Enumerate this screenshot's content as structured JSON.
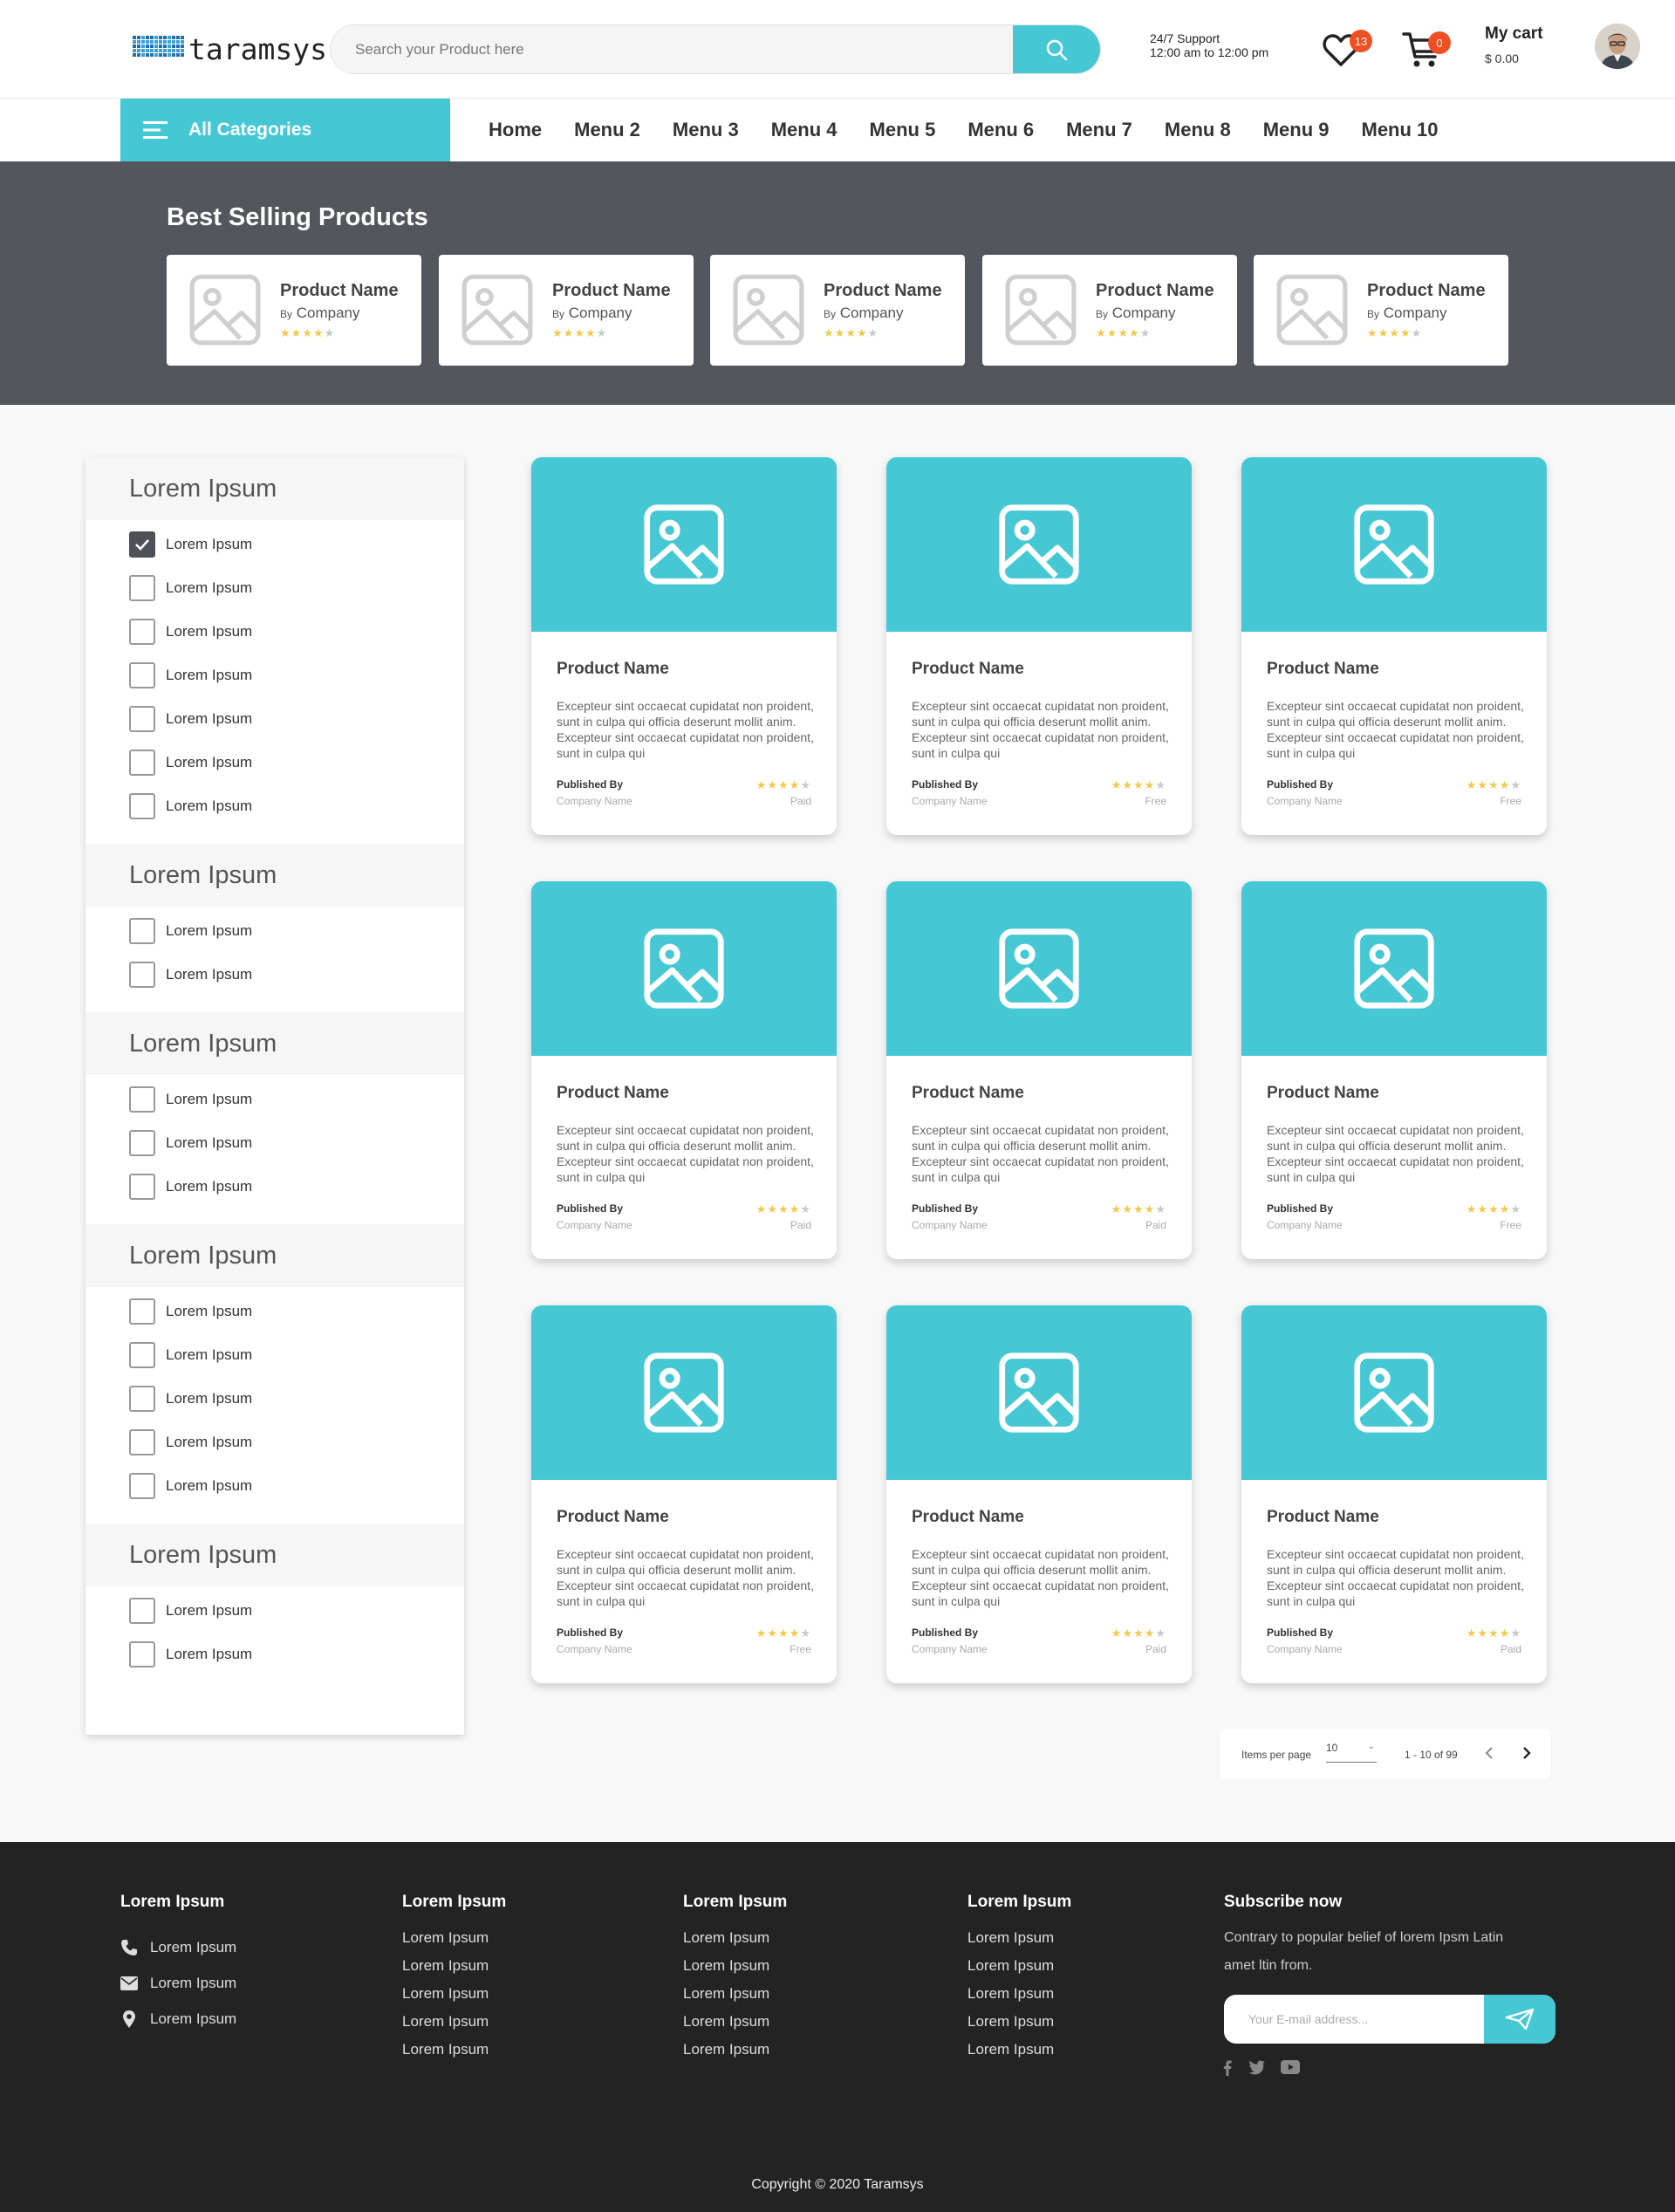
{
  "header": {
    "logo_text": "taramsys",
    "search_placeholder": "Search your Product here",
    "support_line1": "24/7 Support",
    "support_line2": "12:00 am to 12:00 pm",
    "wishlist_count": "13",
    "cart_count": "0",
    "cart_title": "My cart",
    "cart_amount": "$ 0.00"
  },
  "nav": {
    "all_categories": "All Categories",
    "menu": [
      "Home",
      "Menu 2",
      "Menu 3",
      "Menu 4",
      "Menu 5",
      "Menu 6",
      "Menu 7",
      "Menu 8",
      "Menu 9",
      "Menu 10"
    ]
  },
  "best_selling": {
    "title": "Best Selling Products",
    "items": [
      {
        "name": "Product Name",
        "by": "By",
        "company": "Company",
        "rating": 4
      },
      {
        "name": "Product Name",
        "by": "By",
        "company": "Company",
        "rating": 4
      },
      {
        "name": "Product Name",
        "by": "By",
        "company": "Company",
        "rating": 4
      },
      {
        "name": "Product Name",
        "by": "By",
        "company": "Company",
        "rating": 4
      },
      {
        "name": "Product Name",
        "by": "By",
        "company": "Company",
        "rating": 4
      }
    ]
  },
  "filters": [
    {
      "title": "Lorem Ipsum",
      "options": [
        {
          "label": "Lorem Ipsum",
          "checked": true
        },
        {
          "label": "Lorem Ipsum",
          "checked": false
        },
        {
          "label": "Lorem Ipsum",
          "checked": false
        },
        {
          "label": "Lorem Ipsum",
          "checked": false
        },
        {
          "label": "Lorem Ipsum",
          "checked": false
        },
        {
          "label": "Lorem Ipsum",
          "checked": false
        },
        {
          "label": "Lorem Ipsum",
          "checked": false
        }
      ]
    },
    {
      "title": "Lorem Ipsum",
      "options": [
        {
          "label": "Lorem Ipsum",
          "checked": false
        },
        {
          "label": "Lorem Ipsum",
          "checked": false
        }
      ]
    },
    {
      "title": "Lorem Ipsum",
      "options": [
        {
          "label": "Lorem Ipsum",
          "checked": false
        },
        {
          "label": "Lorem Ipsum",
          "checked": false
        },
        {
          "label": "Lorem Ipsum",
          "checked": false
        }
      ]
    },
    {
      "title": "Lorem Ipsum",
      "options": [
        {
          "label": "Lorem Ipsum",
          "checked": false
        },
        {
          "label": "Lorem Ipsum",
          "checked": false
        },
        {
          "label": "Lorem Ipsum",
          "checked": false
        },
        {
          "label": "Lorem Ipsum",
          "checked": false
        },
        {
          "label": "Lorem Ipsum",
          "checked": false
        }
      ]
    },
    {
      "title": "Lorem Ipsum",
      "options": [
        {
          "label": "Lorem Ipsum",
          "checked": false
        },
        {
          "label": "Lorem Ipsum",
          "checked": false
        }
      ]
    }
  ],
  "products": [
    {
      "name": "Product Name",
      "description": "Excepteur sint occaecat cupidatat non proident, sunt in culpa qui officia deserunt mollit anim. Excepteur sint occaecat cupidatat non proident, sunt in culpa qui",
      "published_by": "Published By",
      "company": "Company Name",
      "rating": 4,
      "price": "Paid"
    },
    {
      "name": "Product Name",
      "description": "Excepteur sint occaecat cupidatat non proident, sunt in culpa qui officia deserunt mollit anim. Excepteur sint occaecat cupidatat non proident, sunt in culpa qui",
      "published_by": "Published By",
      "company": "Company Name",
      "rating": 4,
      "price": "Free"
    },
    {
      "name": "Product Name",
      "description": "Excepteur sint occaecat cupidatat non proident, sunt in culpa qui officia deserunt mollit anim. Excepteur sint occaecat cupidatat non proident, sunt in culpa qui",
      "published_by": "Published By",
      "company": "Company Name",
      "rating": 4,
      "price": "Free"
    },
    {
      "name": "Product Name",
      "description": "Excepteur sint occaecat cupidatat non proident, sunt in culpa qui officia deserunt mollit anim. Excepteur sint occaecat cupidatat non proident, sunt in culpa qui",
      "published_by": "Published By",
      "company": "Company Name",
      "rating": 4,
      "price": "Paid"
    },
    {
      "name": "Product Name",
      "description": "Excepteur sint occaecat cupidatat non proident, sunt in culpa qui officia deserunt mollit anim. Excepteur sint occaecat cupidatat non proident, sunt in culpa qui",
      "published_by": "Published By",
      "company": "Company Name",
      "rating": 4,
      "price": "Paid"
    },
    {
      "name": "Product Name",
      "description": "Excepteur sint occaecat cupidatat non proident, sunt in culpa qui officia deserunt mollit anim. Excepteur sint occaecat cupidatat non proident, sunt in culpa qui",
      "published_by": "Published By",
      "company": "Company Name",
      "rating": 4,
      "price": "Free"
    },
    {
      "name": "Product Name",
      "description": "Excepteur sint occaecat cupidatat non proident, sunt in culpa qui officia deserunt mollit anim. Excepteur sint occaecat cupidatat non proident, sunt in culpa qui",
      "published_by": "Published By",
      "company": "Company Name",
      "rating": 4,
      "price": "Free"
    },
    {
      "name": "Product Name",
      "description": "Excepteur sint occaecat cupidatat non proident, sunt in culpa qui officia deserunt mollit anim. Excepteur sint occaecat cupidatat non proident, sunt in culpa qui",
      "published_by": "Published By",
      "company": "Company Name",
      "rating": 4,
      "price": "Paid"
    },
    {
      "name": "Product Name",
      "description": "Excepteur sint occaecat cupidatat non proident, sunt in culpa qui officia deserunt mollit anim. Excepteur sint occaecat cupidatat non proident, sunt in culpa qui",
      "published_by": "Published By",
      "company": "Company Name",
      "rating": 4,
      "price": "Paid"
    }
  ],
  "pagination": {
    "items_per_page_label": "Items per page",
    "items_per_page": "10",
    "range": "1 - 10 of 99"
  },
  "footer": {
    "col1": {
      "title": "Lorem Ipsum",
      "contacts": [
        {
          "icon": "phone-icon",
          "text": "Lorem Ipsum"
        },
        {
          "icon": "mail-icon",
          "text": "Lorem Ipsum"
        },
        {
          "icon": "location-icon",
          "text": "Lorem Ipsum"
        }
      ]
    },
    "link_columns": [
      {
        "title": "Lorem Ipsum",
        "links": [
          "Lorem Ipsum",
          "Lorem Ipsum",
          "Lorem Ipsum",
          "Lorem Ipsum",
          "Lorem Ipsum"
        ]
      },
      {
        "title": "Lorem Ipsum",
        "links": [
          "Lorem Ipsum",
          "Lorem Ipsum",
          "Lorem Ipsum",
          "Lorem Ipsum",
          "Lorem Ipsum"
        ]
      },
      {
        "title": "Lorem Ipsum",
        "links": [
          "Lorem Ipsum",
          "Lorem Ipsum",
          "Lorem Ipsum",
          "Lorem Ipsum",
          "Lorem Ipsum"
        ]
      }
    ],
    "subscribe": {
      "title": "Subscribe now",
      "text": "Contrary to popular belief of lorem Ipsm Latin amet ltin from.",
      "placeholder": "Your E-mail address..."
    },
    "socials": [
      "facebook-icon",
      "twitter-icon",
      "youtube-icon"
    ],
    "copyright": "Copyright © 2020 Taramsys"
  },
  "colors": {
    "accent": "#45c8d4",
    "badge": "#f04e23",
    "banner": "#53575d",
    "footer": "#232323",
    "star": "#f2c94c"
  }
}
